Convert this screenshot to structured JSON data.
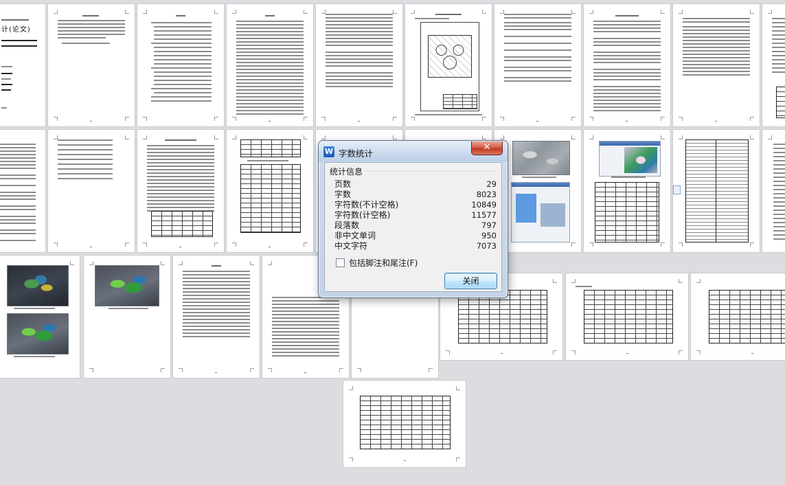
{
  "dialog": {
    "title": "字数统计",
    "app_icon_letter": "W",
    "close_glyph": "✕",
    "section_label": "统计信息",
    "stats": [
      {
        "label": "页数",
        "value": "29"
      },
      {
        "label": "字数",
        "value": "8023"
      },
      {
        "label": "字符数(不计空格)",
        "value": "10849"
      },
      {
        "label": "字符数(计空格)",
        "value": "11577"
      },
      {
        "label": "段落数",
        "value": "797"
      },
      {
        "label": "非中文单词",
        "value": "950"
      },
      {
        "label": "中文字符",
        "value": "7073"
      }
    ],
    "checkbox_label": "包括脚注和尾注(F)",
    "checkbox_checked": false,
    "close_button_label": "关闭"
  },
  "cover": {
    "title_fragment": "计(论文)"
  },
  "colors": {
    "workspace_bg": "#dcdde0",
    "dialog_frame": "#c5d4e6",
    "close_button_red": "#c23b22",
    "ok_button_blue": "#bee6fd"
  }
}
